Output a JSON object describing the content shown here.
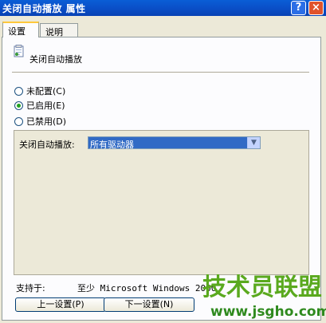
{
  "window": {
    "title": "关闭自动播放 属性",
    "help_label": "?",
    "close_label": "×"
  },
  "tabs": [
    {
      "label": "设置"
    },
    {
      "label": "说明"
    }
  ],
  "policy": {
    "title": "关闭自动播放",
    "icon": "policy-icon"
  },
  "radios": [
    {
      "label": "未配置(C)",
      "checked": false
    },
    {
      "label": "已启用(E)",
      "checked": true
    },
    {
      "label": "已禁用(D)",
      "checked": false
    }
  ],
  "options": {
    "label": "关闭自动播放:",
    "select_value": "所有驱动器"
  },
  "support": {
    "label": "支持于:",
    "value": "至少 Microsoft Windows 2000"
  },
  "buttons": {
    "prev": "上一设置(P)",
    "next": "下一设置(N)"
  },
  "watermark": {
    "brand": "技术员联盟",
    "url": "www.jsgho.com"
  },
  "colors": {
    "titlebar": "#0a4fc8",
    "selection": "#316ac5",
    "tab_highlight": "#ffc83c",
    "watermark_green": "#5aa91e"
  }
}
